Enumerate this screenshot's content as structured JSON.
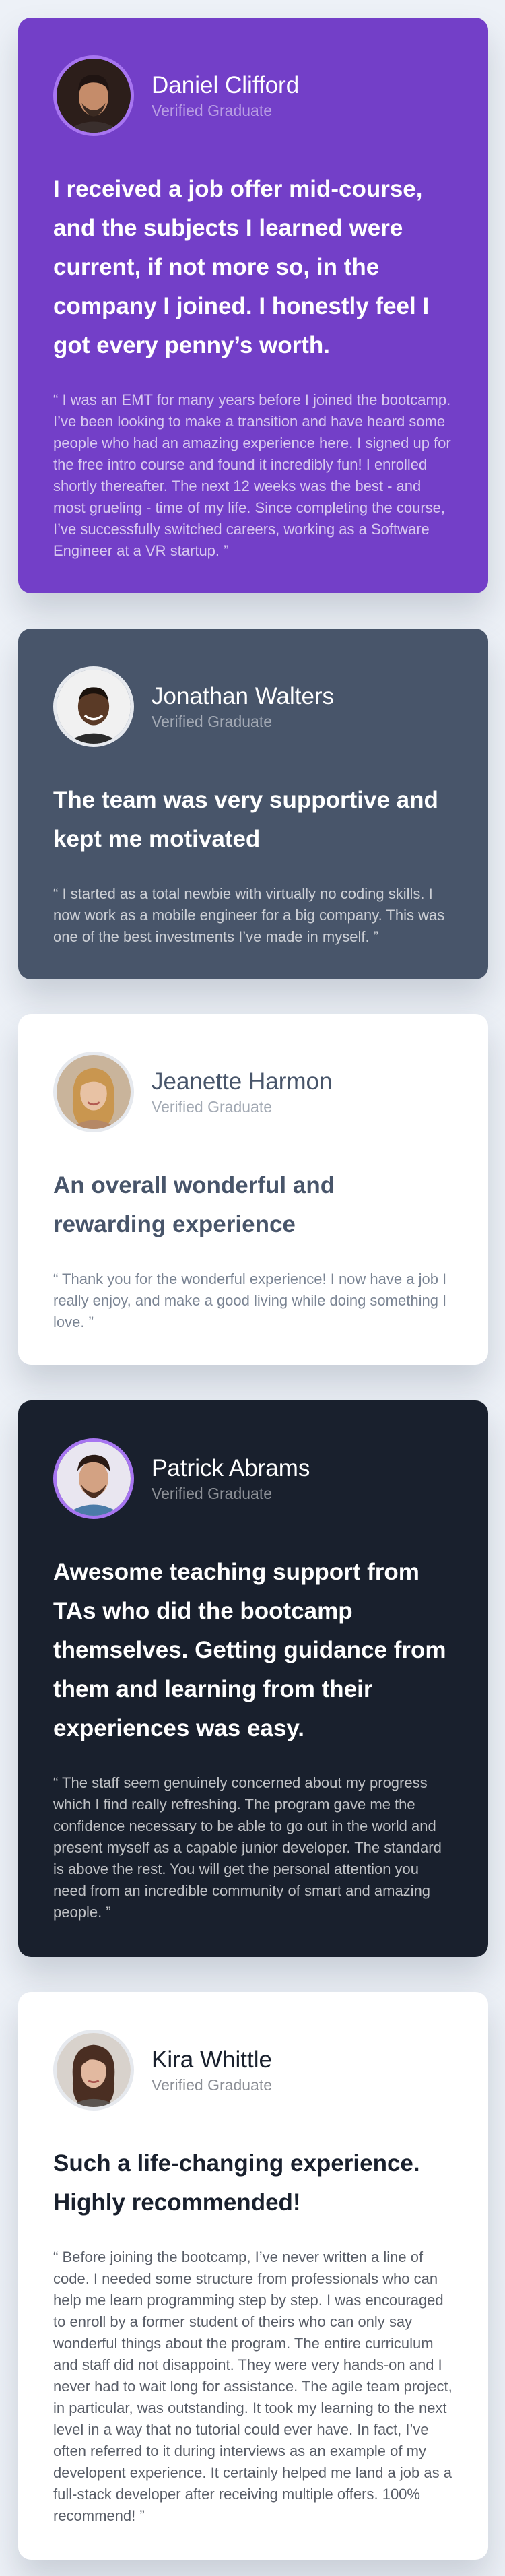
{
  "testimonials": [
    {
      "name": "Daniel Clifford",
      "role": "Verified Graduate",
      "headline": "I received a job offer mid-course, and the subjects I learned were current, if not more so, in the company I joined. I honestly feel I got every penny’s worth.",
      "quote": "“ I was an EMT for many years before I joined the bootcamp. I’ve been looking to make a transition and have heard some people who had an amazing experience here. I signed up for the free intro course and found it incredibly fun! I enrolled shortly thereafter. The next 12 weeks was the best - and most grueling - time of my life. Since completing the course, I’ve successfully switched careers, working as a Software Engineer at a VR startup. ”",
      "card_color": "#733fc8"
    },
    {
      "name": "Jonathan Walters",
      "role": "Verified Graduate",
      "headline": "The team was very supportive and kept me motivated",
      "quote": "“ I started as a total newbie with virtually no coding skills. I now work as a mobile engineer for a big company. This was one of the best investments I’ve made in myself. ”",
      "card_color": "#48556a"
    },
    {
      "name": "Jeanette Harmon",
      "role": "Verified Graduate",
      "headline": "An overall wonderful and rewarding experience",
      "quote": "“ Thank you for the wonderful experience! I now have a job I really enjoy, and make a good living while doing something I love. ”",
      "card_color": "#ffffff"
    },
    {
      "name": "Patrick Abrams",
      "role": "Verified Graduate",
      "headline": "Awesome teaching support from TAs who did the bootcamp themselves. Getting guidance from them and learning from their experiences was easy.",
      "quote": "“ The staff seem genuinely concerned about my progress which I find really refreshing. The program gave me the confidence necessary to be able to go out in the world and present myself as a capable junior developer. The standard is above the rest. You will get the personal attention you need from an incredible community of smart and amazing people. ”",
      "card_color": "#19202d"
    },
    {
      "name": "Kira Whittle",
      "role": "Verified Graduate",
      "headline": "Such a life-changing experience. Highly recommended!",
      "quote": "“ Before joining the bootcamp, I’ve never written a line of code. I needed some structure from professionals who can help me learn programming step by step. I was encouraged to enroll by a former student of theirs who can only say wonderful things about the program. The entire curriculum and staff did not disappoint. They were very hands-on and I never had to wait long for assistance. The agile team project, in particular, was outstanding. It took my learning to the next level in a way that no tutorial could ever have. In fact, I’ve often referred to it during interviews as an example of my developent experience. It certainly helped me land a job as a full-stack developer after receiving multiple offers. 100% recommend! ”",
      "card_color": "#ffffff"
    }
  ],
  "avatar_icon": "person-photo"
}
